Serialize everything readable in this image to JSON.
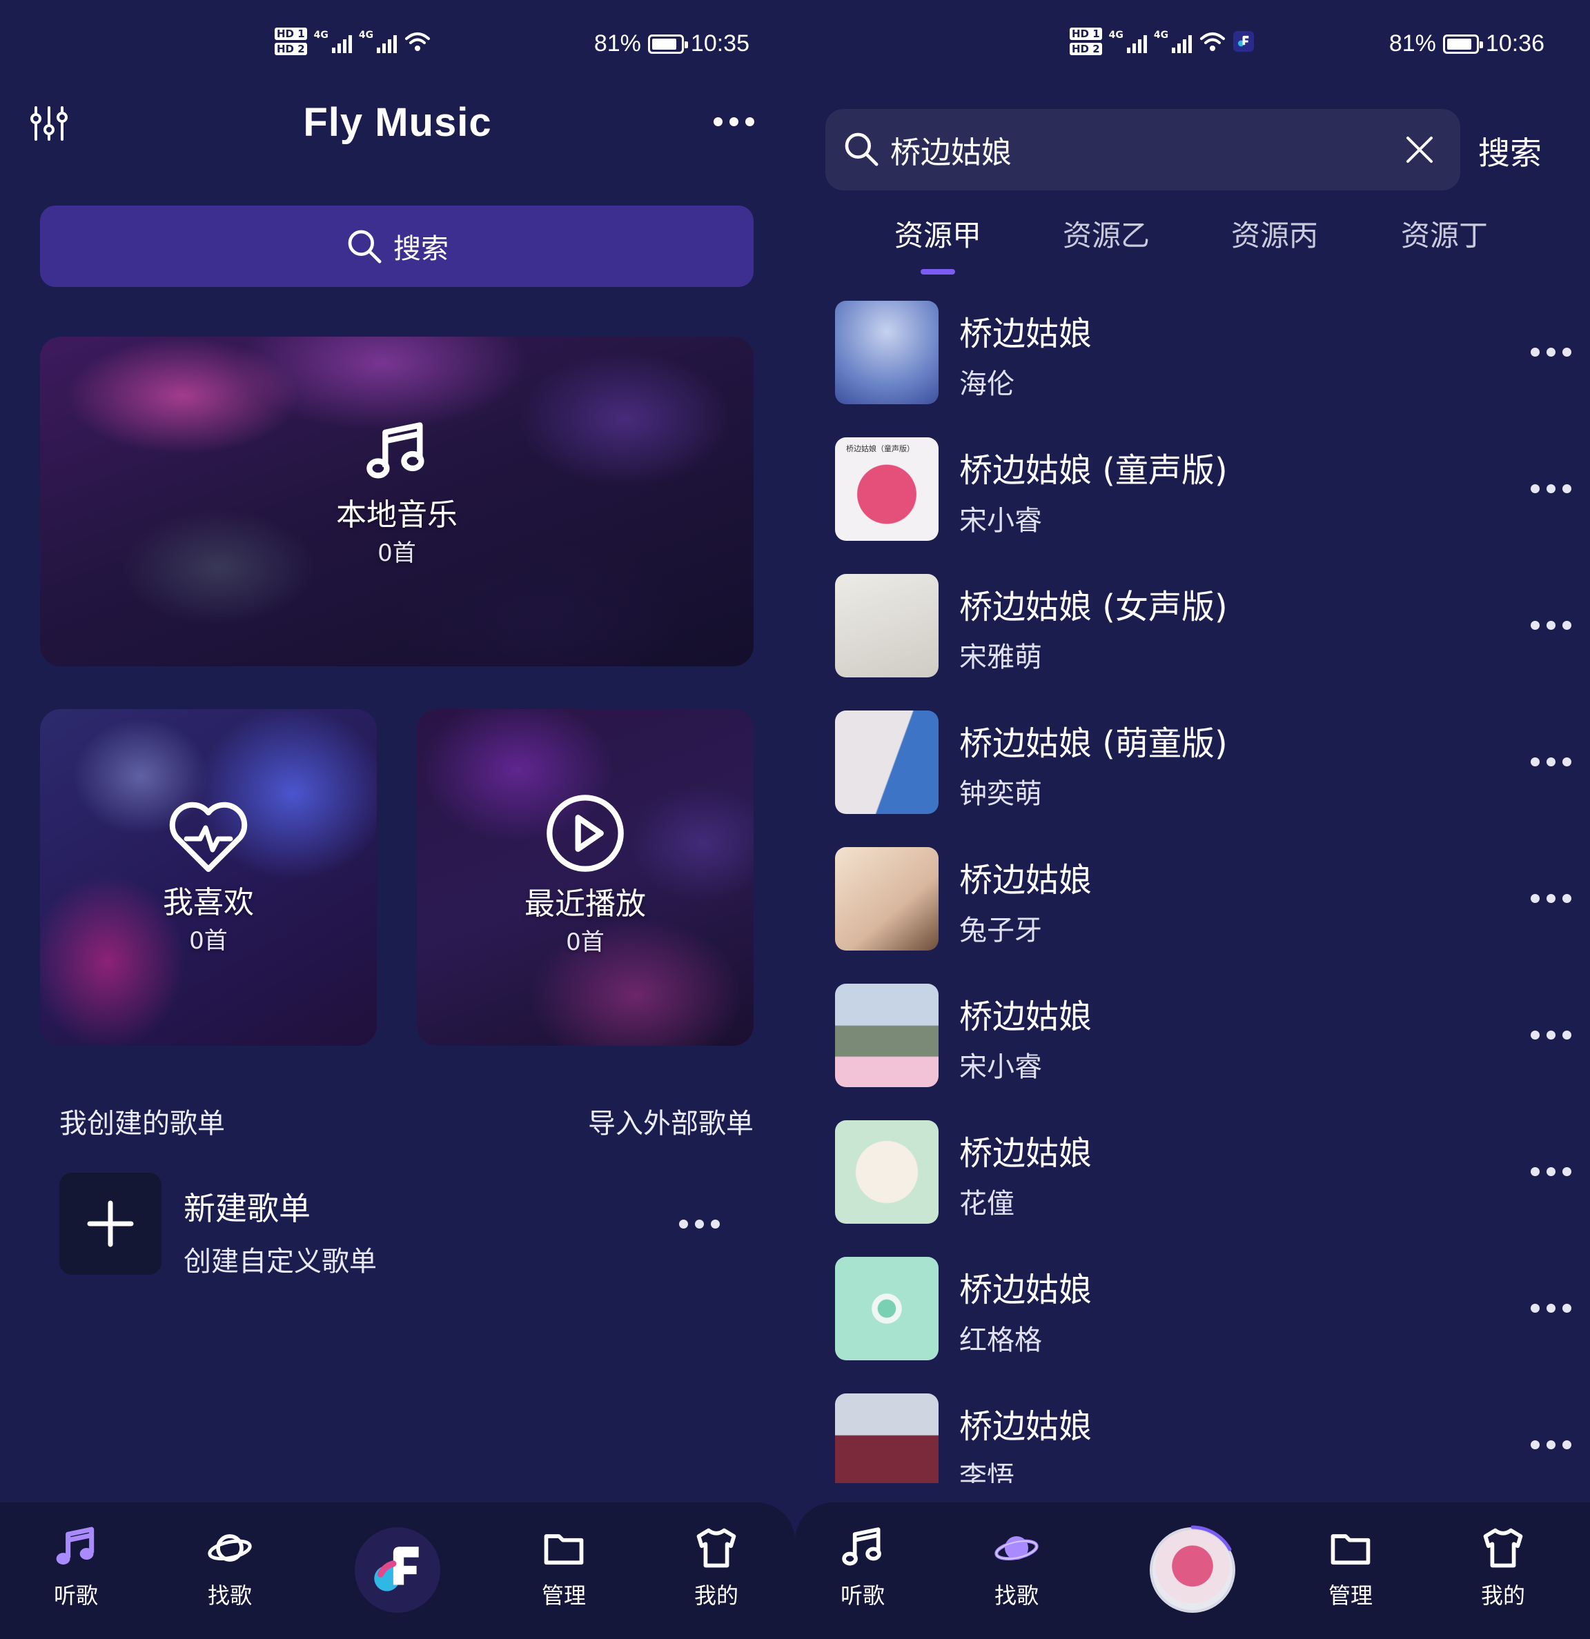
{
  "left": {
    "status": {
      "battery": "81%",
      "time": "10:35"
    },
    "app_title": "Fly Music",
    "search_label": "搜索",
    "cards": {
      "local": {
        "title": "本地音乐",
        "count": "0首"
      },
      "favorite": {
        "title": "我喜欢",
        "count": "0首"
      },
      "recent": {
        "title": "最近播放",
        "count": "0首"
      }
    },
    "sections": {
      "my_playlists": "我创建的歌单",
      "import": "导入外部歌单"
    },
    "new_playlist": {
      "title": "新建歌单",
      "subtitle": "创建自定义歌单"
    },
    "nav": {
      "listen": "听歌",
      "find": "找歌",
      "manage": "管理",
      "mine": "我的"
    },
    "nav_active": "listen"
  },
  "right": {
    "status": {
      "battery": "81%",
      "time": "10:36"
    },
    "search": {
      "value": "桥边姑娘",
      "button": "搜索"
    },
    "tabs": [
      "资源甲",
      "资源乙",
      "资源丙",
      "资源丁"
    ],
    "active_tab": 0,
    "results": [
      {
        "title": "桥边姑娘",
        "artist": "海伦"
      },
      {
        "title": "桥边姑娘 (童声版)",
        "artist": "宋小睿",
        "cover_text": "桥边姑娘（童声版）"
      },
      {
        "title": "桥边姑娘 (女声版)",
        "artist": "宋雅萌"
      },
      {
        "title": "桥边姑娘 (萌童版)",
        "artist": "钟奕萌"
      },
      {
        "title": "桥边姑娘",
        "artist": "兔子牙"
      },
      {
        "title": "桥边姑娘",
        "artist": "宋小睿"
      },
      {
        "title": "桥边姑娘",
        "artist": "花僮"
      },
      {
        "title": "桥边姑娘",
        "artist": "红格格"
      },
      {
        "title": "桥边姑娘",
        "artist": "李悟"
      }
    ],
    "nav": {
      "listen": "听歌",
      "find": "找歌",
      "manage": "管理",
      "mine": "我的"
    },
    "nav_active": "find"
  },
  "colors": {
    "background": "#1b1d4e",
    "search_bar": "#3d2f8f",
    "nav_bar": "#14163a",
    "accent": "#7b5cf2",
    "active_icon": "#a98bff"
  },
  "icons": {
    "equalizer": "equalizer-icon",
    "more": "more-dots-icon",
    "search": "search-icon",
    "note": "music-note-icon",
    "heart": "heart-pulse-icon",
    "play": "play-circle-icon",
    "plus": "plus-icon",
    "planet": "planet-icon",
    "folder": "folder-icon",
    "shirt": "tshirt-icon",
    "close": "close-icon"
  }
}
